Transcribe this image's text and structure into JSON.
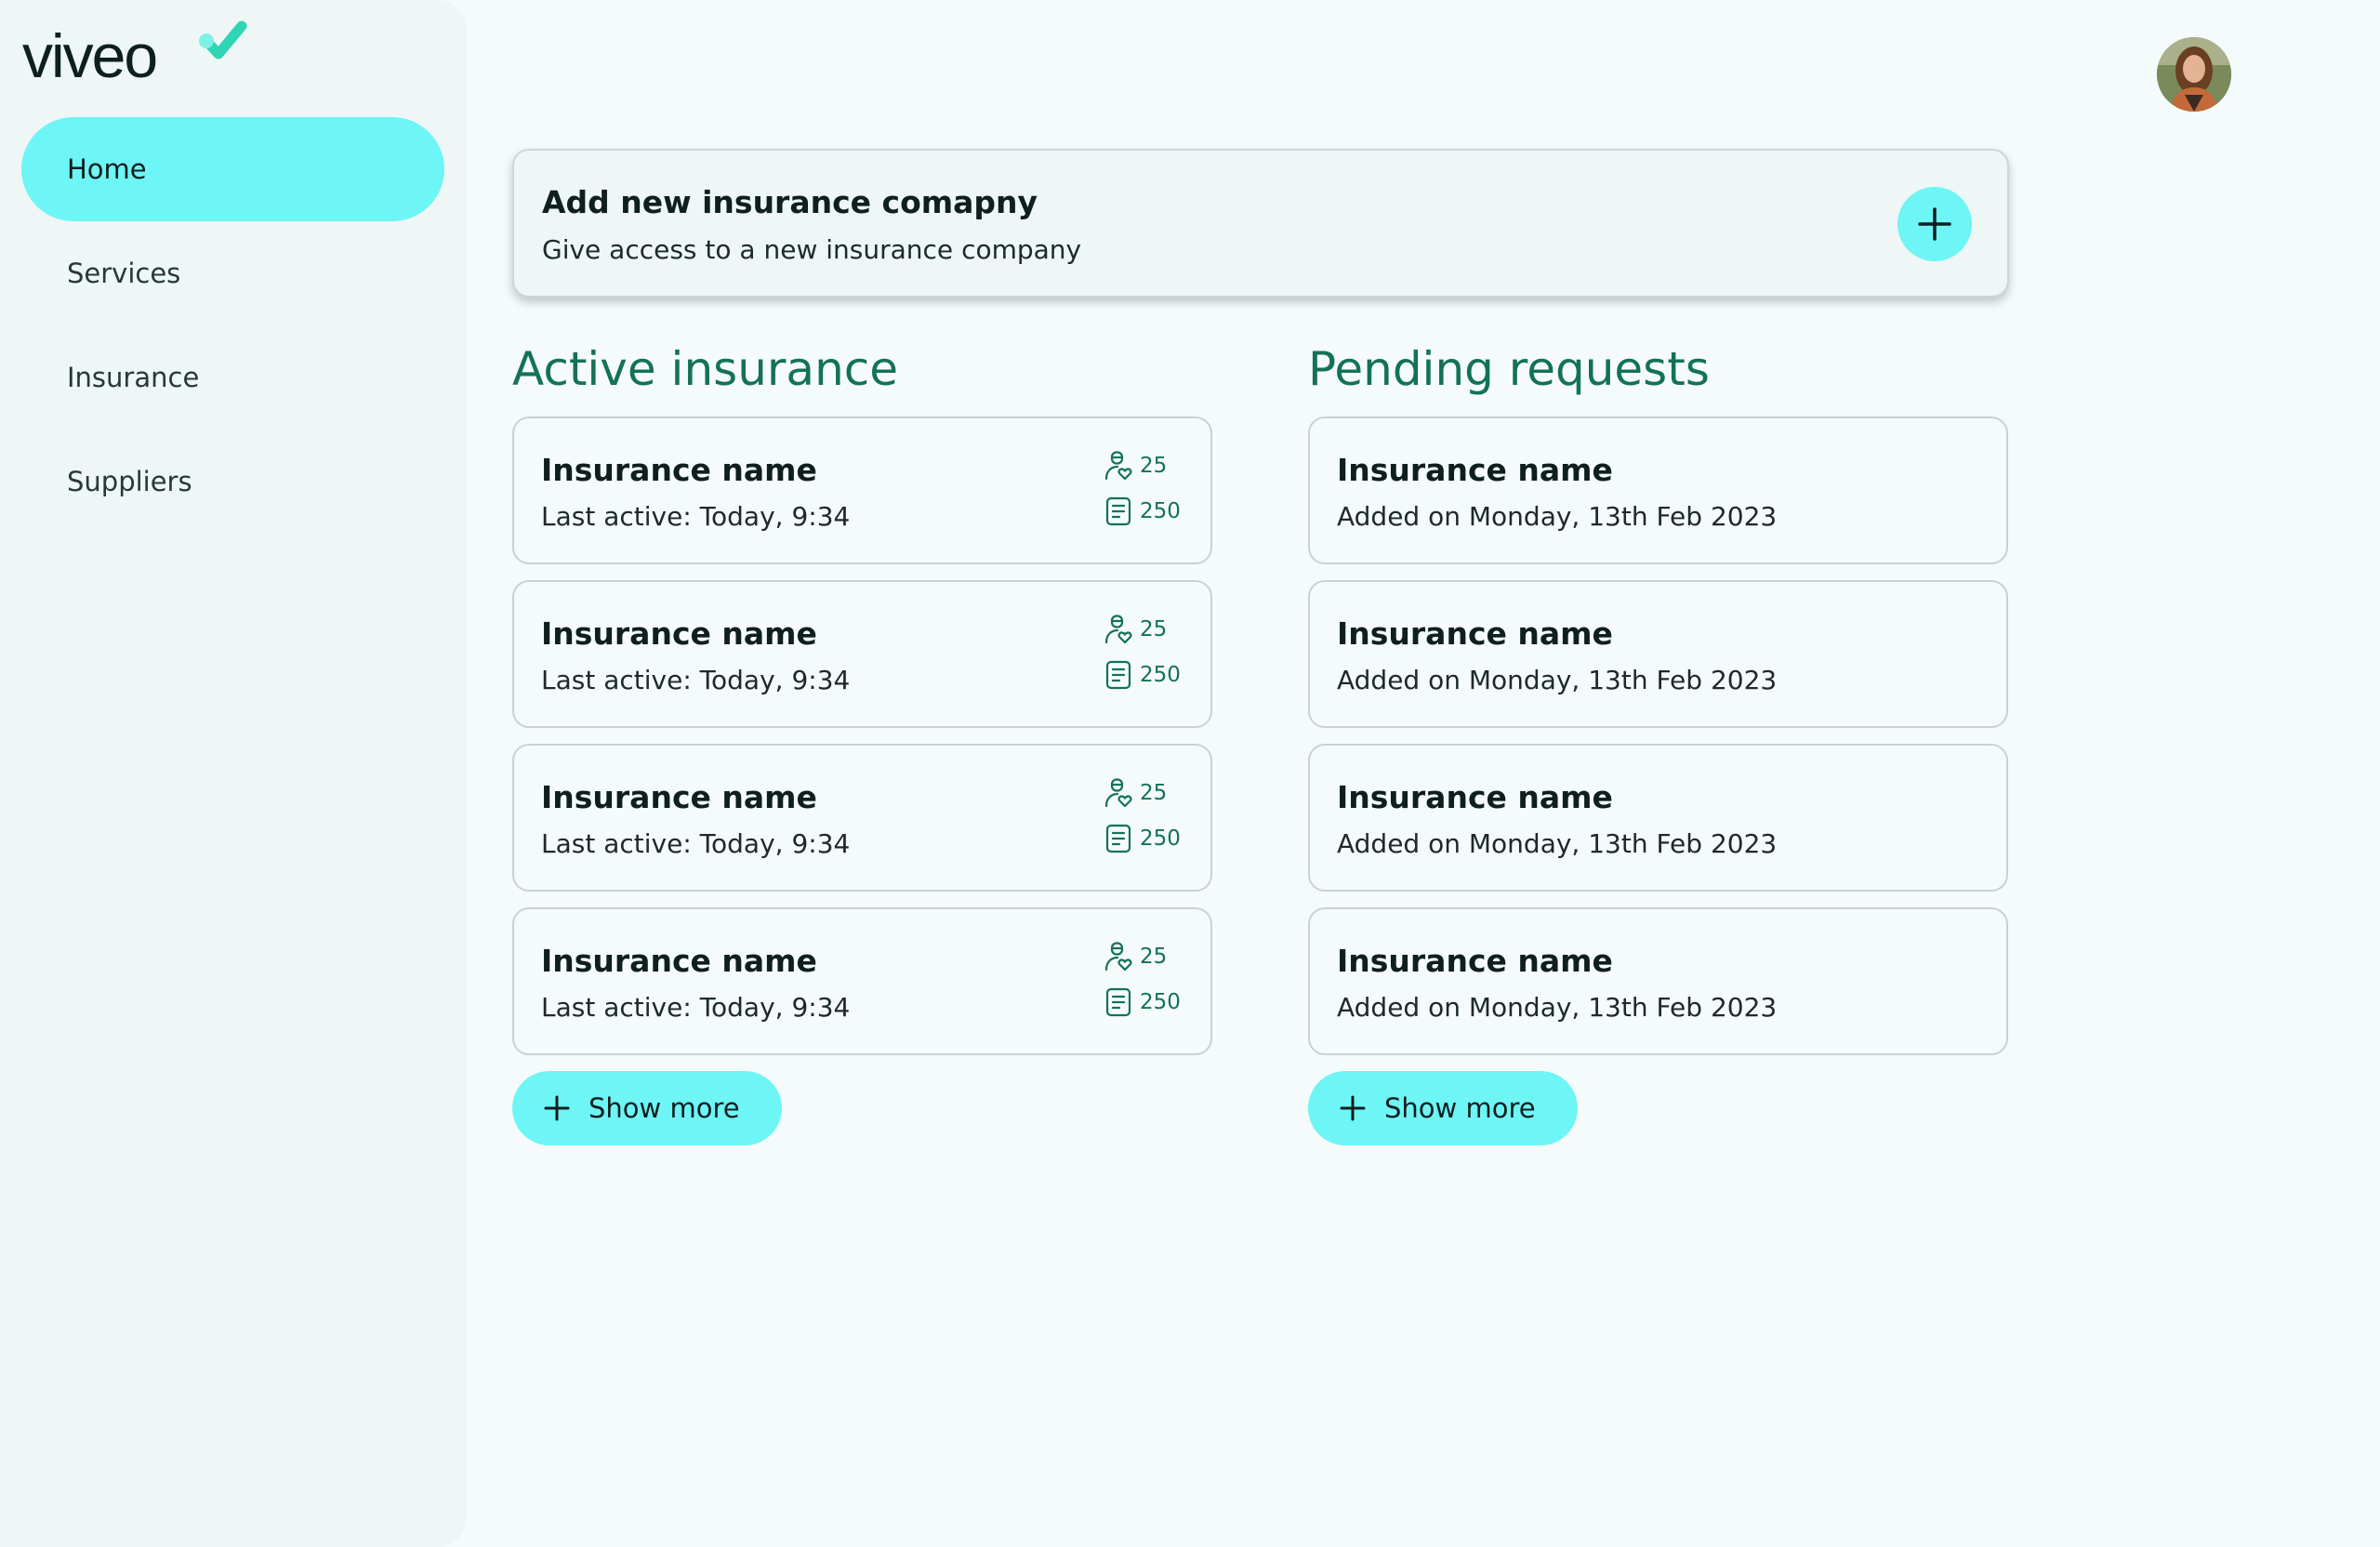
{
  "brand": {
    "name": "viveo"
  },
  "nav": {
    "items": [
      {
        "label": "Home",
        "active": true
      },
      {
        "label": "Services",
        "active": false
      },
      {
        "label": "Insurance",
        "active": false
      },
      {
        "label": "Suppliers",
        "active": false
      }
    ]
  },
  "add_card": {
    "title": "Add new insurance comapny",
    "subtitle": "Give access to a new insurance company"
  },
  "active": {
    "title": "Active insurance",
    "items": [
      {
        "name": "Insurance name",
        "meta": "Last active: Today, 9:34",
        "users": "25",
        "docs": "250"
      },
      {
        "name": "Insurance name",
        "meta": "Last active: Today, 9:34",
        "users": "25",
        "docs": "250"
      },
      {
        "name": "Insurance name",
        "meta": "Last active: Today, 9:34",
        "users": "25",
        "docs": "250"
      },
      {
        "name": "Insurance name",
        "meta": "Last active: Today, 9:34",
        "users": "25",
        "docs": "250"
      }
    ],
    "show_more": "Show more"
  },
  "pending": {
    "title": "Pending requests",
    "items": [
      {
        "name": "Insurance name",
        "meta": "Added on Monday, 13th Feb 2023"
      },
      {
        "name": "Insurance name",
        "meta": "Added on Monday, 13th Feb 2023"
      },
      {
        "name": "Insurance name",
        "meta": "Added on Monday, 13th Feb 2023"
      },
      {
        "name": "Insurance name",
        "meta": "Added on Monday, 13th Feb 2023"
      }
    ],
    "show_more": "Show more"
  },
  "colors": {
    "accent": "#6ef5f5",
    "heading_green": "#137255",
    "sidebar_bg": "#eef6f6"
  },
  "icons": {
    "add": "plus-icon",
    "users": "person-heart-icon",
    "docs": "document-icon",
    "avatar": "user-avatar"
  }
}
